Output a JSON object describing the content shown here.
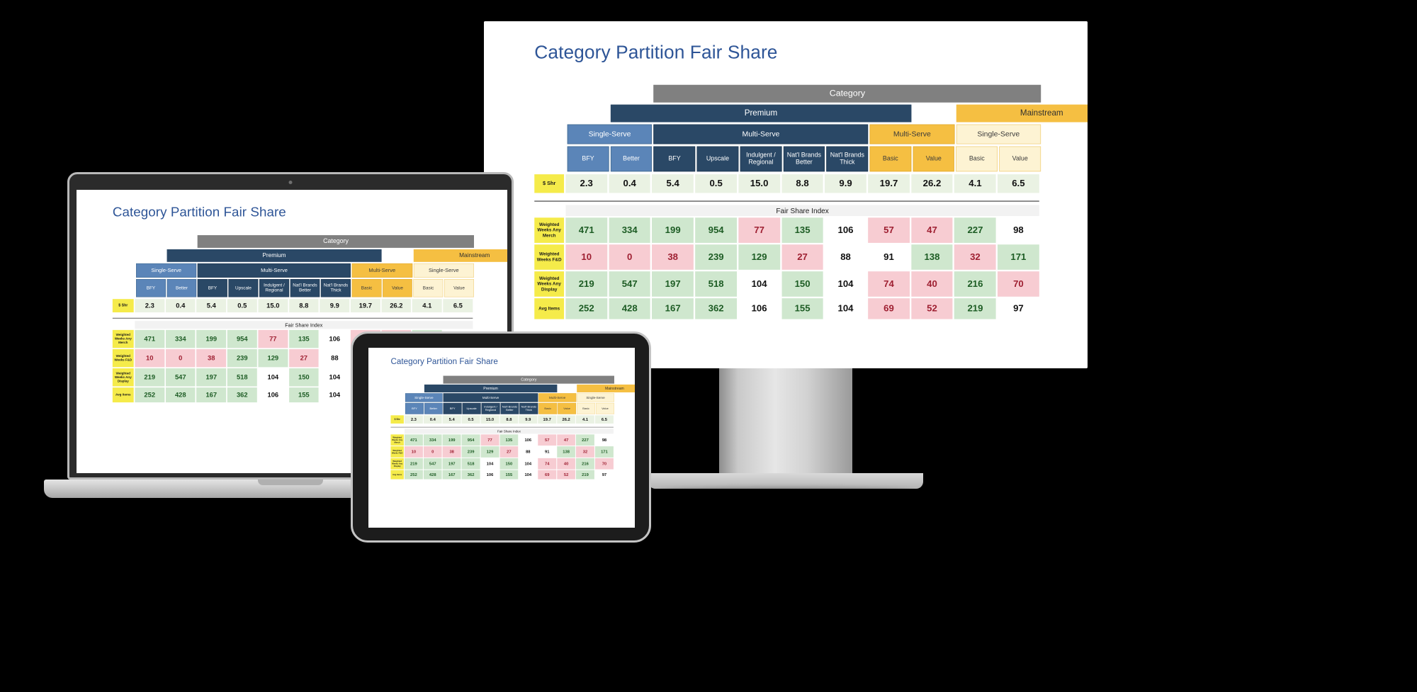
{
  "slide": {
    "title": "Category Partition Fair Share",
    "fair_share_index_label": "Fair Share Index",
    "share_row_label": "$ Shr"
  },
  "hierarchy": {
    "level1": [
      {
        "label": "Category",
        "style": "category",
        "span": 11
      }
    ],
    "level2": [
      {
        "label": "Premium",
        "style": "premium",
        "span": 7
      },
      {
        "label": "Mainstream",
        "style": "mainstream",
        "span": 4
      }
    ],
    "level3": [
      {
        "label": "Single-Serve",
        "style": "ss-prem",
        "span": 2
      },
      {
        "label": "Multi-Serve",
        "style": "ms-prem",
        "span": 5
      },
      {
        "label": "Multi-Serve",
        "style": "ms-main",
        "span": 2
      },
      {
        "label": "Single-Serve",
        "style": "ss-main",
        "span": 2
      }
    ],
    "level4": [
      {
        "label": "BFY",
        "style": "blue-lt"
      },
      {
        "label": "Better",
        "style": "blue-lt"
      },
      {
        "label": "BFY",
        "style": "blue-dk"
      },
      {
        "label": "Upscale",
        "style": "blue-dk"
      },
      {
        "label": "Indulgent / Regional",
        "style": "blue-dk"
      },
      {
        "label": "Nat'l Brands Better",
        "style": "blue-dk"
      },
      {
        "label": "Nat'l Brands Thick",
        "style": "blue-dk"
      },
      {
        "label": "Basic",
        "style": "amber"
      },
      {
        "label": "Value",
        "style": "amber"
      },
      {
        "label": "Basic",
        "style": "cream"
      },
      {
        "label": "Value",
        "style": "cream"
      }
    ]
  },
  "chart_data": {
    "type": "table",
    "title": "Category Partition Fair Share",
    "categories": [
      "Premium / Single-Serve / BFY",
      "Premium / Single-Serve / Better",
      "Premium / Multi-Serve / BFY",
      "Premium / Multi-Serve / Upscale",
      "Premium / Multi-Serve / Indulgent / Regional",
      "Premium / Multi-Serve / Nat'l Brands Better",
      "Premium / Multi-Serve / Nat'l Brands Thick",
      "Mainstream / Multi-Serve / Basic",
      "Mainstream / Multi-Serve / Value",
      "Mainstream / Single-Serve / Basic",
      "Mainstream / Single-Serve / Value"
    ],
    "dollar_share": {
      "label": "$ Shr",
      "values": [
        2.3,
        0.4,
        5.4,
        0.5,
        15.0,
        8.8,
        9.9,
        19.7,
        26.2,
        4.1,
        6.5
      ]
    },
    "section_label": "Fair Share Index",
    "series": [
      {
        "name": "Weighted Weeks Any Merch",
        "values": [
          471,
          334,
          199,
          954,
          77,
          135,
          106,
          57,
          47,
          227,
          98
        ],
        "states": [
          "pos",
          "pos",
          "pos",
          "pos",
          "neg",
          "pos",
          "neu",
          "neg",
          "neg",
          "pos",
          "neu"
        ]
      },
      {
        "name": "Weighted Weeks F&D",
        "values": [
          10,
          0,
          38,
          239,
          129,
          27,
          88,
          91,
          138,
          32,
          171
        ],
        "states": [
          "neg",
          "neg",
          "neg",
          "pos",
          "pos",
          "neg",
          "neu",
          "neu",
          "pos",
          "neg",
          "pos"
        ]
      },
      {
        "name": "Weighted Weeks Any Display",
        "values": [
          219,
          547,
          197,
          518,
          104,
          150,
          104,
          74,
          40,
          216,
          70
        ],
        "states": [
          "pos",
          "pos",
          "pos",
          "pos",
          "neu",
          "pos",
          "neu",
          "neg",
          "neg",
          "pos",
          "neg"
        ]
      },
      {
        "name": "Avg Items",
        "values": [
          252,
          428,
          167,
          362,
          106,
          155,
          104,
          69,
          52,
          219,
          97
        ],
        "states": [
          "pos",
          "pos",
          "pos",
          "pos",
          "neu",
          "pos",
          "neu",
          "neg",
          "neg",
          "pos",
          "neu"
        ]
      }
    ],
    "ylabel": "",
    "xlabel": "",
    "grid": false,
    "legend": "none"
  },
  "colors": {
    "title_blue": "#2e5597",
    "category_gray": "#808080",
    "premium_navy": "#2a4866",
    "mainstream_amber": "#f5bf42",
    "single_serve_blue": "#5b85b8",
    "single_serve_cream": "#fdf3d3",
    "row_label_yellow": "#f5eb4a",
    "share_cell_green": "#eaf2e3",
    "positive_green": "#cfe7ce",
    "negative_pink": "#f7ccd2"
  },
  "devices": [
    {
      "name": "desktop-monitor"
    },
    {
      "name": "laptop"
    },
    {
      "name": "tablet"
    }
  ]
}
